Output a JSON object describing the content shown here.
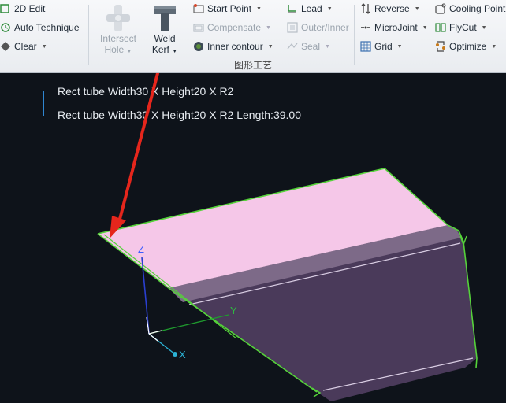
{
  "ribbon": {
    "col1": {
      "edit_2d": "2D Edit",
      "auto_technique": "Auto Technique",
      "clear": "Clear"
    },
    "intersect_hole": {
      "line1": "Intersect",
      "line2": "Hole"
    },
    "weld_kerf": {
      "line1": "Weld",
      "line2": "Kerf"
    },
    "col3": {
      "start_point": "Start Point",
      "compensate": "Compensate",
      "inner_contour": "Inner contour"
    },
    "col4": {
      "lead": "Lead",
      "outer_inner": "Outer/Inner",
      "seal": "Seal"
    },
    "col5": {
      "reverse": "Reverse",
      "microjoint": "MicroJoint",
      "grid": "Grid"
    },
    "col6": {
      "cooling_point": "Cooling Point",
      "flycut": "FlyCut",
      "optimize": "Optimize"
    },
    "group_title": "图形工艺"
  },
  "viewport": {
    "info_line1": "Rect tube Width30 X Height20 X R2",
    "info_line2": "Rect tube Width30 X Height20 X R2 Length:39.00",
    "axes": {
      "z": "Z",
      "y": "Y",
      "x": "X"
    },
    "colors": {
      "background": "#0e131a",
      "top_face": "#f5c7e8",
      "side_face": "#4a3a5a",
      "edge": "#55d23a",
      "arrow": "#e5261c"
    }
  }
}
